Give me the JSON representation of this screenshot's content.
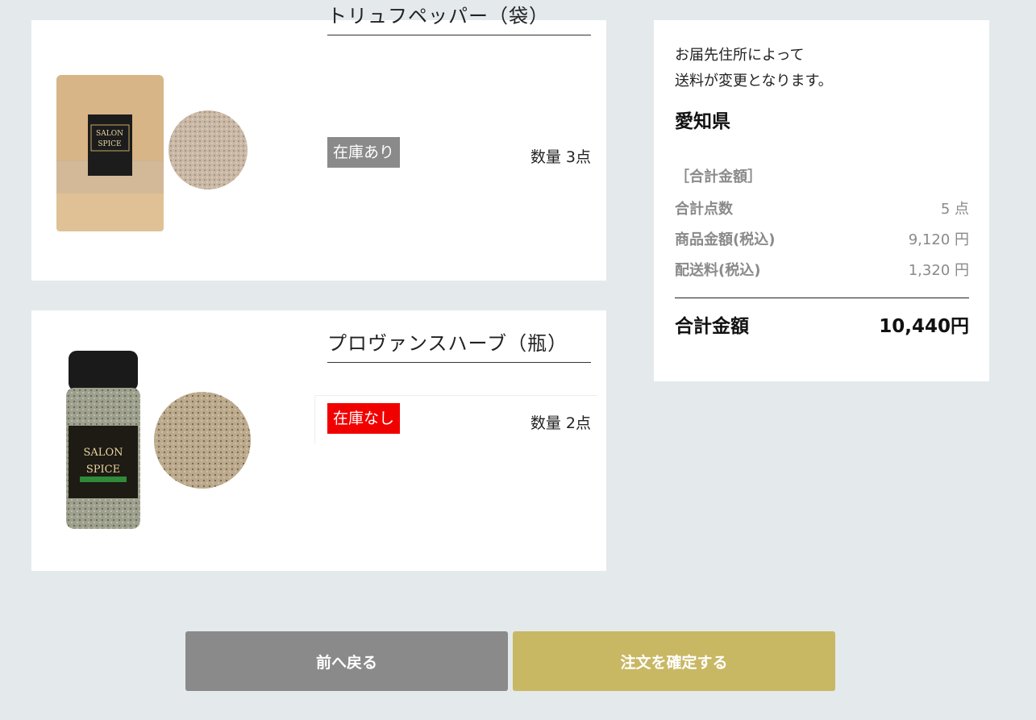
{
  "items": [
    {
      "name": "トリュフペッパー（袋）",
      "stock": "在庫あり",
      "qty": "数量 3点",
      "label": [
        "SALON",
        "SPICE"
      ]
    },
    {
      "name": "プロヴァンスハーブ（瓶）",
      "stock": "在庫なし",
      "qty": "数量 2点",
      "label": [
        "SALON",
        "SPICE"
      ]
    }
  ],
  "summary": {
    "notice_line1": "お届先住所によって",
    "notice_line2": "送料が変更となります。",
    "prefecture": "愛知県",
    "section_title": "［合計金額］",
    "rows": [
      {
        "label": "合計点数",
        "value": "5 点"
      },
      {
        "label": "商品金額(税込)",
        "value": "9,120 円"
      },
      {
        "label": "配送料(税込)",
        "value": "1,320 円"
      }
    ],
    "total_label": "合計金額",
    "total_value": "10,440円"
  },
  "buttons": {
    "back": "前へ戻る",
    "confirm": "注文を確定する"
  },
  "colors": {
    "background": "#e4e9ec",
    "in_stock": "#8a8a8a",
    "out_of_stock": "#f10000",
    "confirm": "#c8b864",
    "back": "#8a8a8a"
  }
}
